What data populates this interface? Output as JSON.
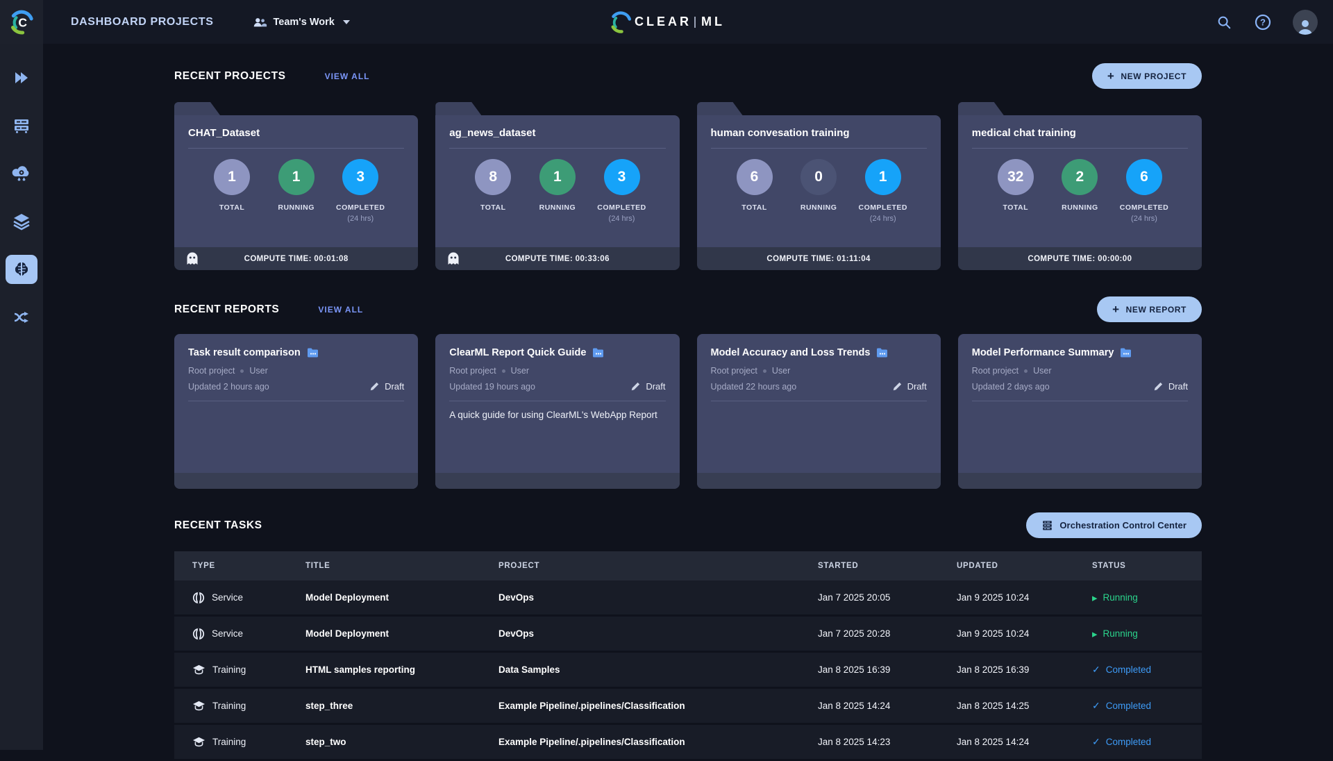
{
  "topbar": {
    "title": "DASHBOARD PROJECTS",
    "team_selector": "Team's Work",
    "logo_clear": "CLEAR",
    "logo_ml": "ML",
    "icons": [
      "search-icon",
      "help-icon",
      "user-avatar"
    ]
  },
  "sidebar": {
    "items": [
      {
        "icon": "projects-icon"
      },
      {
        "icon": "workers-queues-icon"
      },
      {
        "icon": "applications-icon"
      },
      {
        "icon": "datasets-icon"
      },
      {
        "icon": "models-icon",
        "active": true
      },
      {
        "icon": "pipelines-icon"
      }
    ]
  },
  "projects": {
    "title": "RECENT PROJECTS",
    "view_all": "VIEW ALL",
    "new_button": "NEW PROJECT",
    "labels": {
      "total": "TOTAL",
      "running": "RUNNING",
      "completed": "COMPLETED",
      "completed_sub": "(24 hrs)"
    },
    "cards": [
      {
        "name": "CHAT_Dataset",
        "total": "1",
        "running": "1",
        "completed": "3",
        "compute": "COMPUTE TIME: 00:01:08",
        "has_ghost": true
      },
      {
        "name": "ag_news_dataset",
        "total": "8",
        "running": "1",
        "completed": "3",
        "compute": "COMPUTE TIME: 00:33:06",
        "has_ghost": true
      },
      {
        "name": "human convesation training",
        "total": "6",
        "running": "0",
        "completed": "1",
        "compute": "COMPUTE TIME: 01:11:04",
        "has_ghost": false
      },
      {
        "name": "medical chat training",
        "total": "32",
        "running": "2",
        "completed": "6",
        "compute": "COMPUTE TIME: 00:00:00",
        "has_ghost": false
      }
    ]
  },
  "reports": {
    "title": "RECENT REPORTS",
    "view_all": "VIEW ALL",
    "new_button": "NEW REPORT",
    "cards": [
      {
        "name": "Task result comparison",
        "project": "Root project",
        "owner": "User",
        "updated": "Updated 2 hours ago",
        "state": "Draft",
        "description": ""
      },
      {
        "name": "ClearML Report Quick Guide",
        "project": "Root project",
        "owner": "User",
        "updated": "Updated 19 hours ago",
        "state": "Draft",
        "description": "A quick guide for using ClearML's WebApp Report"
      },
      {
        "name": "Model Accuracy and Loss Trends",
        "project": "Root project",
        "owner": "User",
        "updated": "Updated 22 hours ago",
        "state": "Draft",
        "description": ""
      },
      {
        "name": "Model Performance Summary",
        "project": "Root project",
        "owner": "User",
        "updated": "Updated 2 days ago",
        "state": "Draft",
        "description": ""
      }
    ]
  },
  "tasks": {
    "title": "RECENT TASKS",
    "button": "Orchestration Control Center",
    "columns": {
      "type": "TYPE",
      "title": "TITLE",
      "project": "PROJECT",
      "started": "STARTED",
      "updated": "UPDATED",
      "status": "STATUS"
    },
    "rows": [
      {
        "type": "Service",
        "title": "Model Deployment",
        "project": "DevOps",
        "started": "Jan 7 2025 20:05",
        "updated": "Jan 9 2025 10:24",
        "status": "Running"
      },
      {
        "type": "Service",
        "title": "Model Deployment",
        "project": "DevOps",
        "started": "Jan 7 2025 20:28",
        "updated": "Jan 9 2025 10:24",
        "status": "Running"
      },
      {
        "type": "Training",
        "title": "HTML samples reporting",
        "project": "Data Samples",
        "started": "Jan 8 2025 16:39",
        "updated": "Jan 8 2025 16:39",
        "status": "Completed"
      },
      {
        "type": "Training",
        "title": "step_three",
        "project": "Example Pipeline/.pipelines/Classification",
        "started": "Jan 8 2025 14:24",
        "updated": "Jan 8 2025 14:25",
        "status": "Completed"
      },
      {
        "type": "Training",
        "title": "step_two",
        "project": "Example Pipeline/.pipelines/Classification",
        "started": "Jan 8 2025 14:23",
        "updated": "Jan 8 2025 14:24",
        "status": "Completed"
      }
    ]
  },
  "colors": {
    "accent_button": "#a8c8f3",
    "accent_link": "#7b96f8",
    "card_bg": "#414767",
    "total_circle": "#8e95c1",
    "running_circle": "#3d9c76",
    "running_zero_circle": "#4b5374",
    "completed_circle": "#16a3f9",
    "status_running": "#2bd48c",
    "status_completed": "#3e9cf8"
  }
}
